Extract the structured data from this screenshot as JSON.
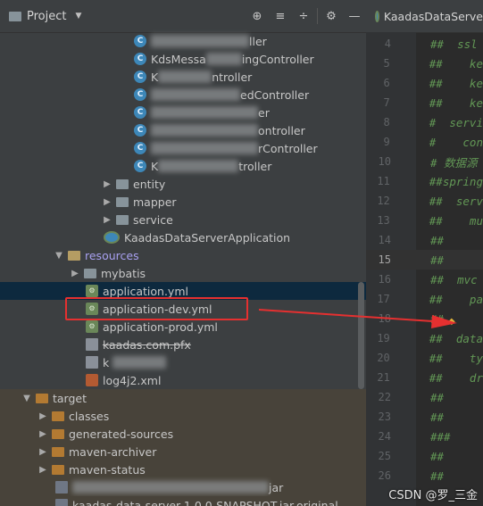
{
  "project_panel": {
    "title": "Project",
    "tools": [
      "⊕",
      "≡",
      "÷",
      "⚙",
      "—"
    ]
  },
  "tree": [
    {
      "type": "class",
      "label": "[redacted]ller",
      "blur_w": 110
    },
    {
      "type": "class",
      "label": "ingController",
      "prefix": "KdsMessa",
      "blur_w": 40
    },
    {
      "type": "class",
      "label": "ntroller",
      "prefix": "K",
      "blur_w": 60
    },
    {
      "type": "class",
      "label": "edController",
      "blur_w": 100
    },
    {
      "type": "class",
      "label": "er",
      "blur_w": 135
    },
    {
      "type": "class",
      "label": "ontroller",
      "blur_w": 120
    },
    {
      "type": "class",
      "label": "rController",
      "blur_w": 120
    },
    {
      "type": "class",
      "label": "troller",
      "prefix": "K",
      "blur_w": 90
    },
    {
      "type": "package",
      "label": "entity",
      "collapsed": true
    },
    {
      "type": "package",
      "label": "mapper",
      "collapsed": true
    },
    {
      "type": "package",
      "label": "service",
      "collapsed": true
    },
    {
      "type": "spring",
      "label": "KaadasDataServerApplication"
    },
    {
      "type": "resources",
      "label": "resources",
      "expanded": true
    },
    {
      "type": "package",
      "label": "mybatis",
      "collapsed": true
    },
    {
      "type": "yml",
      "label": "application.yml",
      "selected": true
    },
    {
      "type": "yml",
      "label": "application-dev.yml"
    },
    {
      "type": "yml",
      "label": "application-prod.yml"
    },
    {
      "type": "file",
      "label": "kaadas.com.pfx"
    },
    {
      "type": "file",
      "label": "k"
    },
    {
      "type": "xml",
      "label": "log4j2.xml"
    },
    {
      "type": "orange",
      "label": "target",
      "expanded": true
    },
    {
      "type": "orange",
      "label": "classes",
      "collapsed": true
    },
    {
      "type": "orange",
      "label": "generated-sources",
      "collapsed": true
    },
    {
      "type": "orange",
      "label": "maven-archiver",
      "collapsed": true
    },
    {
      "type": "orange",
      "label": "maven-status",
      "collapsed": true
    },
    {
      "type": "jar",
      "label": "jar"
    },
    {
      "type": "jar",
      "label": "kaadas-data-server-1.0.0-SNAPSHOT.jar.original"
    }
  ],
  "editor": {
    "tab_label": "KaadasDataServe",
    "lines": [
      {
        "n": "4",
        "code": "##  ssl"
      },
      {
        "n": "5",
        "code": "##    ke"
      },
      {
        "n": "6",
        "code": "##    ke"
      },
      {
        "n": "7",
        "code": "##    ke"
      },
      {
        "n": "8",
        "code": "#  servi"
      },
      {
        "n": "9",
        "code": "#    con"
      },
      {
        "n": "10",
        "code": "# 数据源"
      },
      {
        "n": "11",
        "code": "##spring"
      },
      {
        "n": "12",
        "code": "##  serv"
      },
      {
        "n": "13",
        "code": "##    mu"
      },
      {
        "n": "14",
        "code": "##"
      },
      {
        "n": "15",
        "code": "##",
        "current": true
      },
      {
        "n": "16",
        "code": "##  mvc"
      },
      {
        "n": "17",
        "code": "##    pa"
      },
      {
        "n": "18",
        "code": "##"
      },
      {
        "n": "19",
        "code": "##  data"
      },
      {
        "n": "20",
        "code": "##    ty"
      },
      {
        "n": "21",
        "code": "##    dr"
      },
      {
        "n": "22",
        "code": "##"
      },
      {
        "n": "23",
        "code": "##"
      },
      {
        "n": "24",
        "code": "###"
      },
      {
        "n": "25",
        "code": "##"
      },
      {
        "n": "26",
        "code": "##"
      }
    ]
  },
  "watermark": "CSDN @罗_三金"
}
